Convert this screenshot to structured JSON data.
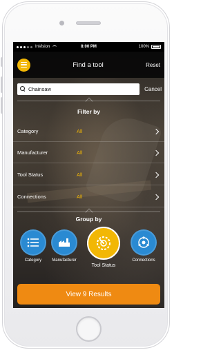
{
  "status_bar": {
    "carrier": "InVision",
    "time": "8:00 PM",
    "battery": "100%"
  },
  "nav": {
    "title": "Find a tool",
    "reset_label": "Reset",
    "menu_icon": "menu-icon"
  },
  "search": {
    "value": "Chainsaw",
    "cancel_label": "Cancel"
  },
  "filter": {
    "title": "Filter by",
    "rows": [
      {
        "label": "Category",
        "value": "All"
      },
      {
        "label": "Manufacturer",
        "value": "All"
      },
      {
        "label": "Tool Status",
        "value": "All"
      },
      {
        "label": "Connections",
        "value": "All"
      }
    ]
  },
  "group": {
    "title": "Group by",
    "items": [
      {
        "label": "Category",
        "icon": "list-icon",
        "selected": false
      },
      {
        "label": "Manufacturer",
        "icon": "factory-icon",
        "selected": false
      },
      {
        "label": "Tool Status",
        "icon": "gauge-icon",
        "selected": true
      },
      {
        "label": "Connections",
        "icon": "connections-icon",
        "selected": false
      }
    ]
  },
  "results_button": "View 9 Results",
  "colors": {
    "accent": "#f2b705",
    "primary_button": "#ef8a12",
    "group_blue": "#2a8ad2"
  }
}
